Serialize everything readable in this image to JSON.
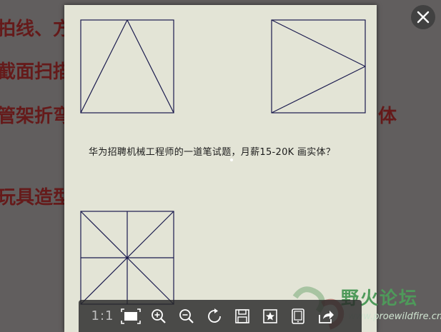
{
  "background_document": {
    "lines": [
      "拍线、方",
      "截面扫描",
      "管架折弯",
      "体",
      "玩具造型"
    ]
  },
  "image": {
    "question": "华为招聘机械工程师的一道笔试题，月薪15-20K  画实体？"
  },
  "toolbar": {
    "actual_size_label": "1:1"
  },
  "watermark": {
    "title": "野火论坛",
    "url": "www.proewildfire.cn"
  },
  "colors": {
    "drawing_line": "#1a1a4e",
    "paper": "#e3e4d6",
    "watermark_green": "#4e9a5a"
  }
}
